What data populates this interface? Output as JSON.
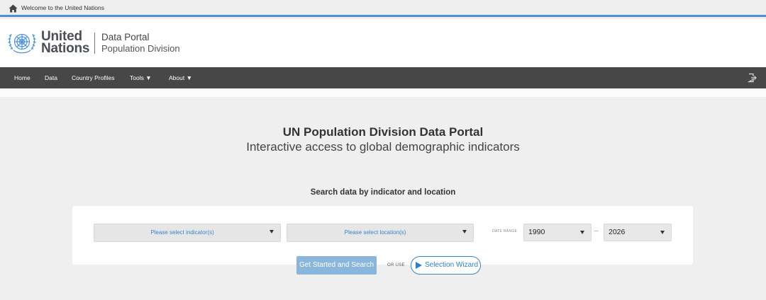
{
  "topbar": {
    "welcome": "Welcome to the United Nations",
    "icon": "home-icon"
  },
  "header": {
    "logo_line1": "United",
    "logo_line2": "Nations",
    "portal_title": "Data Portal",
    "portal_subtitle": "Population Division"
  },
  "nav": {
    "items": [
      {
        "label": "Home"
      },
      {
        "label": "Data"
      },
      {
        "label": "Country Profiles"
      },
      {
        "label": "Tools ▼"
      },
      {
        "label": "About ▼"
      }
    ],
    "login_icon": "login-icon"
  },
  "hero": {
    "title": "UN Population Division Data Portal",
    "subtitle": "Interactive access to global demographic indicators"
  },
  "search": {
    "heading": "Search data by indicator and location",
    "indicator_placeholder": "Please select indicator(s)",
    "location_placeholder": "Please select location(s)",
    "date_range_label": "DATE RANGE",
    "year_from": "1990",
    "year_to": "2026",
    "dash": "–",
    "start_button": "Get Started and Search",
    "or_use": "OR USE",
    "wizard_button": "Selection Wizard"
  },
  "colors": {
    "accent_blue": "#3a85d0",
    "nav_bg": "#474747",
    "start_button_bg": "#8ab6dc",
    "topbar_border": "#4e8fd4"
  }
}
